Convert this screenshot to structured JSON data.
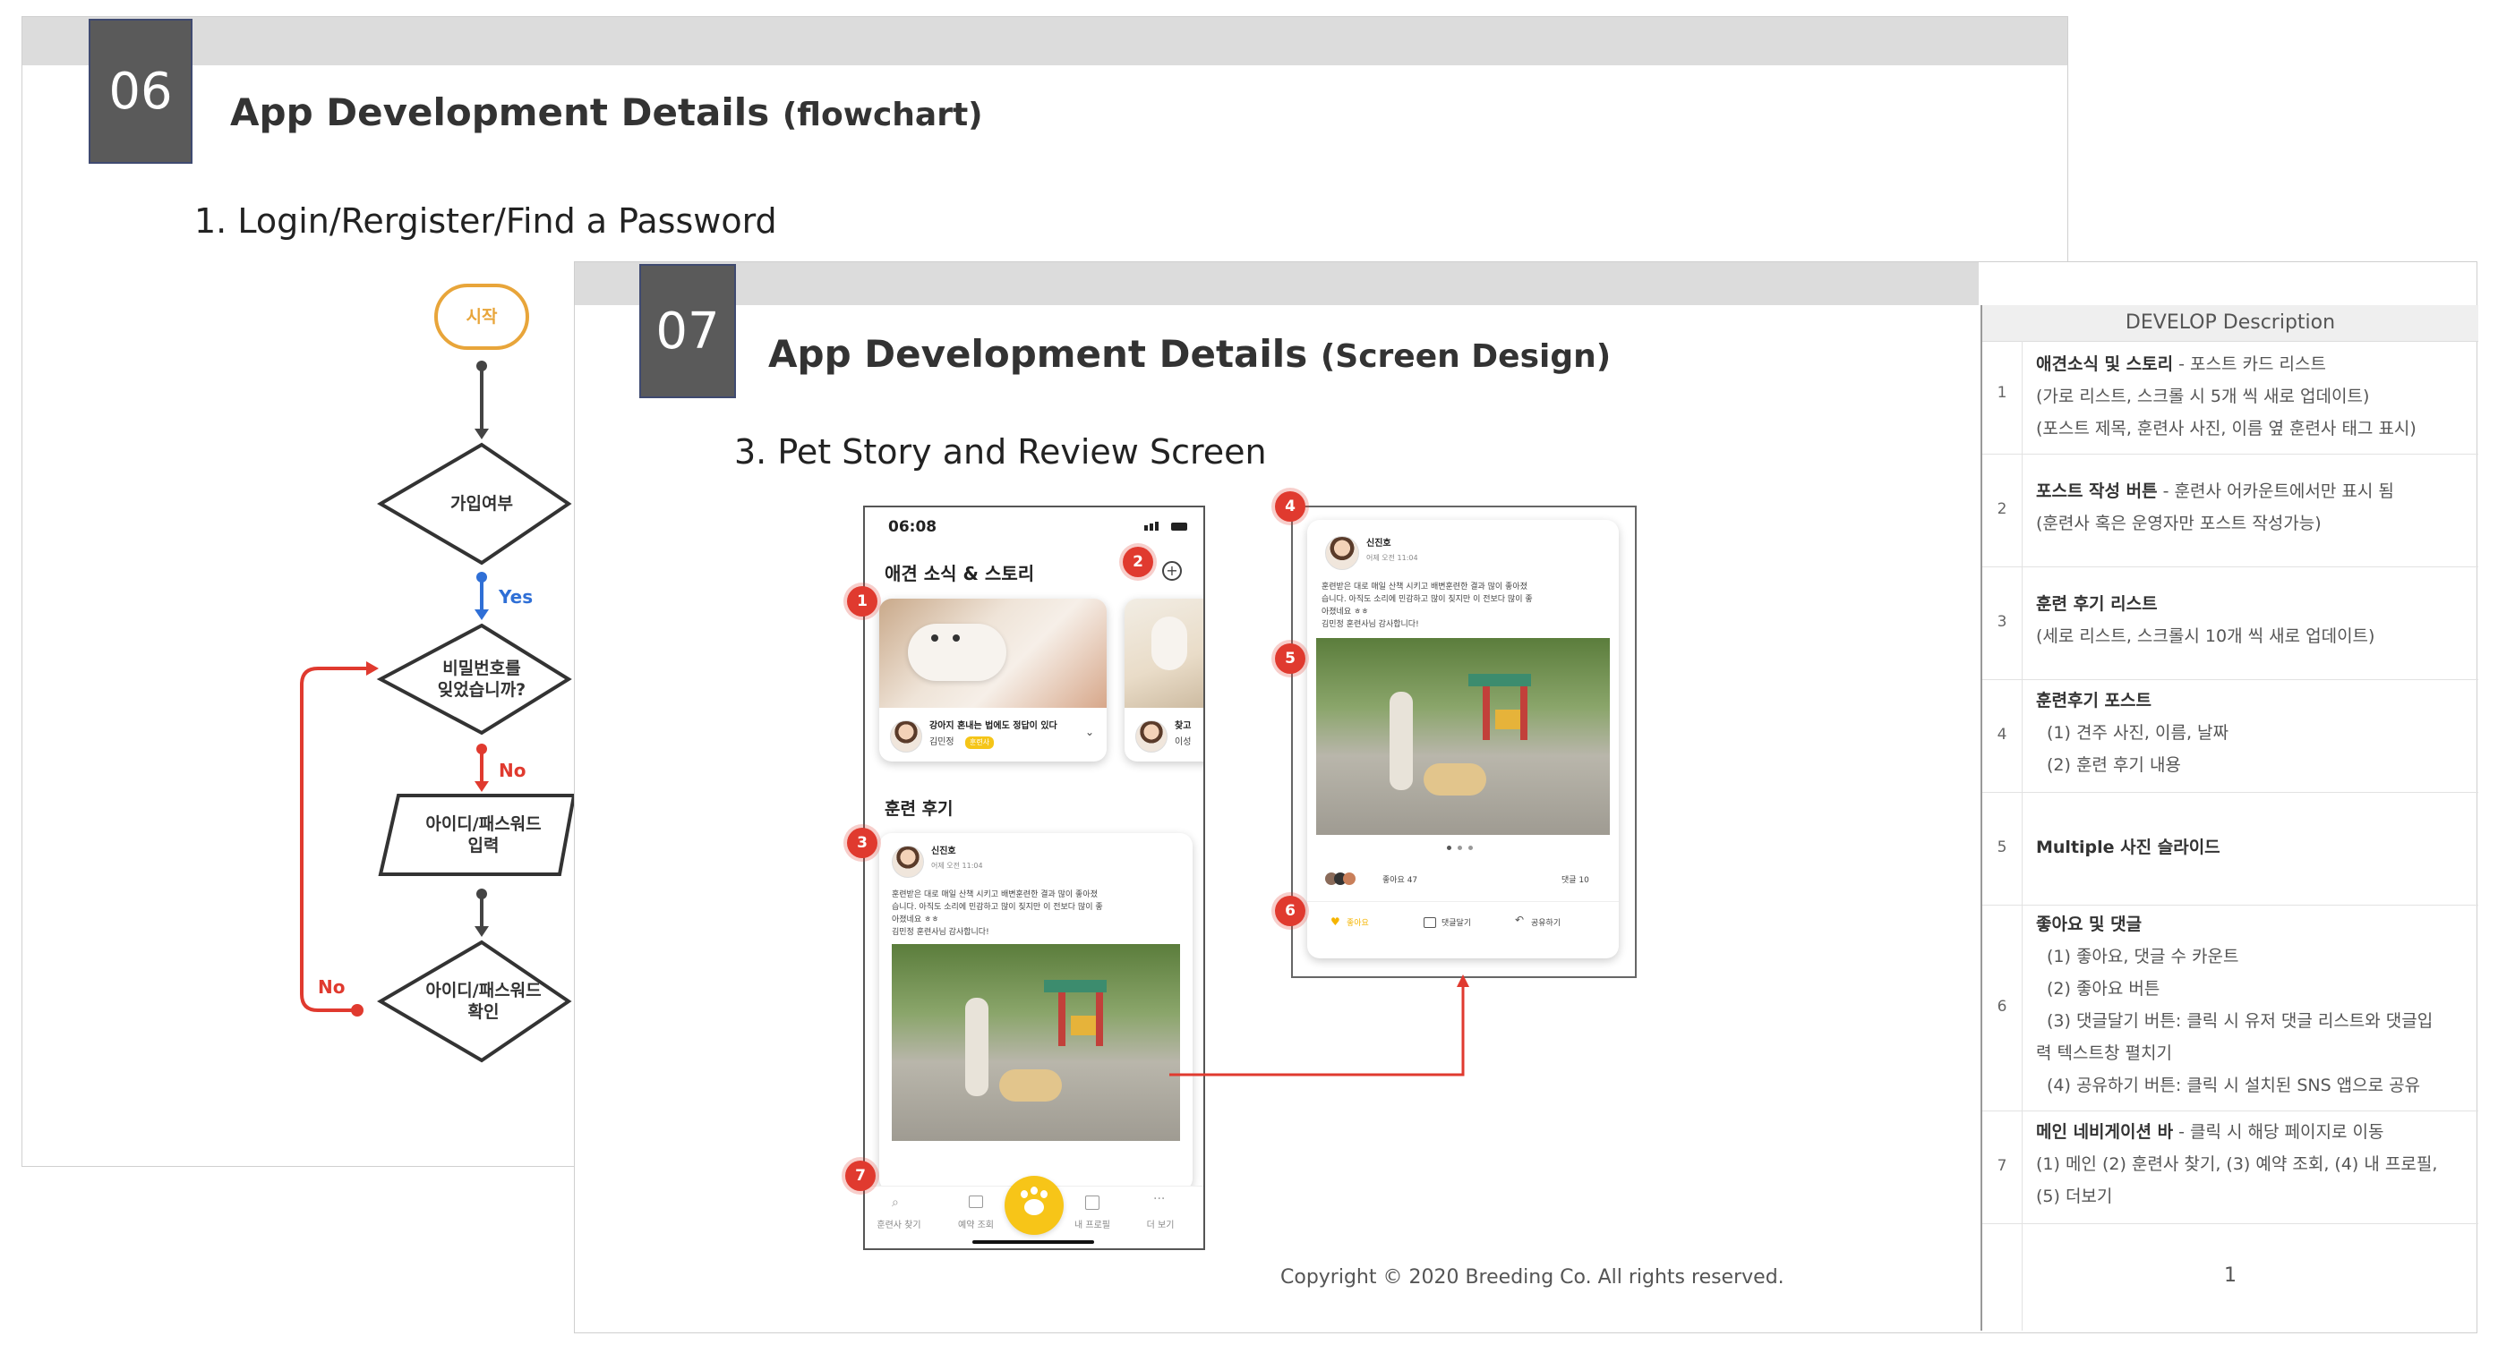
{
  "slide06": {
    "number": "06",
    "title": "App Development Details",
    "title_paren": "(flowchart)",
    "section": "1. Login/Rergister/Find a Password",
    "flowchart": {
      "start": "시작",
      "q1": "가입여부",
      "yes": "Yes",
      "q2_line1": "비밀번호를",
      "q2_line2": "잊었습니까?",
      "no1": "No",
      "input_line1": "아이디/패스워드",
      "input_line2": "입력",
      "q3_line1": "아이디/패스워드",
      "q3_line2": "확인",
      "no2": "No"
    }
  },
  "slide07": {
    "number": "07",
    "title": "App Development Details",
    "title_paren": "(Screen Design)",
    "section": "3. Pet Story and Review Screen",
    "copyright": "Copyright © 2020 Breeding Co. All rights reserved.",
    "page_number": "1",
    "phone1": {
      "time": "06:08",
      "heading": "애견 소식 & 스토리",
      "card_title": "강아지 혼내는 법에도 정답이 있다",
      "card_author": "김민정",
      "card_badge": "훈련사",
      "card2_title": "찾고",
      "card2_author": "이성",
      "review_heading": "훈련 후기",
      "review_name": "신진호",
      "review_time": "어제 오전 11:04",
      "review_text1": "훈련받은 대로 매일 산책 시키고 배변훈련한 결과 많이 좋아졌",
      "review_text2": "습니다. 아직도 소리에 민감하고 많이 짖지만 이 전보다 많이 좋",
      "review_text3": "아졌네요 ㅎㅎ",
      "review_text4": "김민정 훈련사님 감사합니다!",
      "nav": [
        "훈련사 찾기",
        "예약 조회",
        "",
        "내 프로필",
        "더 보기"
      ]
    },
    "phone2": {
      "name": "신진호",
      "time": "어제 오전 11:04",
      "text1": "훈련받은 대로 매일 산책 시키고 배변훈련한 결과 많이 좋아졌",
      "text2": "습니다. 아직도 소리에 민감하고 많이 짖지만 이 전보다 많이 좋",
      "text3": "아졌네요 ㅎㅎ",
      "text4": "김민정 훈련사님 감사합니다!",
      "likes": "좋아요 47",
      "comments": "댓글 10",
      "like_btn": "좋아요",
      "comment_btn": "댓글달기",
      "share_btn": "공유하기"
    },
    "markers": [
      "1",
      "2",
      "3",
      "4",
      "5",
      "6",
      "7"
    ],
    "description": {
      "header": "DEVELOP Description",
      "rows": [
        {
          "num": "1",
          "bold": "애견소식 및 스토리",
          "rest": " - 포스트 카드 리스트",
          "lines": [
            "(가로 리스트, 스크롤 시 5개 씩 새로 업데이트)",
            "(포스트 제목, 훈련사 사진, 이름 옆 훈련사 태그 표시)"
          ]
        },
        {
          "num": "2",
          "bold": "포스트 작성 버튼",
          "rest": " - 훈련사 어카운트에서만 표시 됨",
          "lines": [
            "(훈련사 혹은 운영자만 포스트 작성가능)"
          ]
        },
        {
          "num": "3",
          "bold": "훈련 후기 리스트",
          "rest": "",
          "lines": [
            "(세로 리스트, 스크롤시 10개 씩 새로 업데이트)"
          ]
        },
        {
          "num": "4",
          "bold": "훈련후기 포스트",
          "rest": "",
          "lines": [
            "(1) 견주 사진, 이름, 날짜",
            "(2) 훈련 후기 내용"
          ]
        },
        {
          "num": "5",
          "bold": "Multiple 사진 슬라이드",
          "rest": "",
          "lines": []
        },
        {
          "num": "6",
          "bold": "좋아요 및 댓글",
          "rest": "",
          "lines": [
            "(1) 좋아요, 댓글 수 카운트",
            "(2) 좋아요 버튼",
            "(3) 댓글달기 버튼: 클릭 시 유저 댓글 리스트와 댓글입",
            "력 텍스트창 펼치기",
            "(4) 공유하기 버튼: 클릭 시 설치된 SNS 앱으로 공유"
          ]
        },
        {
          "num": "7",
          "bold": "메인 네비게이션 바",
          "rest": " - 클릭 시 해당 페이지로 이동",
          "lines": [
            "(1) 메인 (2) 훈련사 찾기, (3) 예약 조회, (4) 내 프로필,",
            "(5) 더보기"
          ]
        }
      ]
    }
  }
}
